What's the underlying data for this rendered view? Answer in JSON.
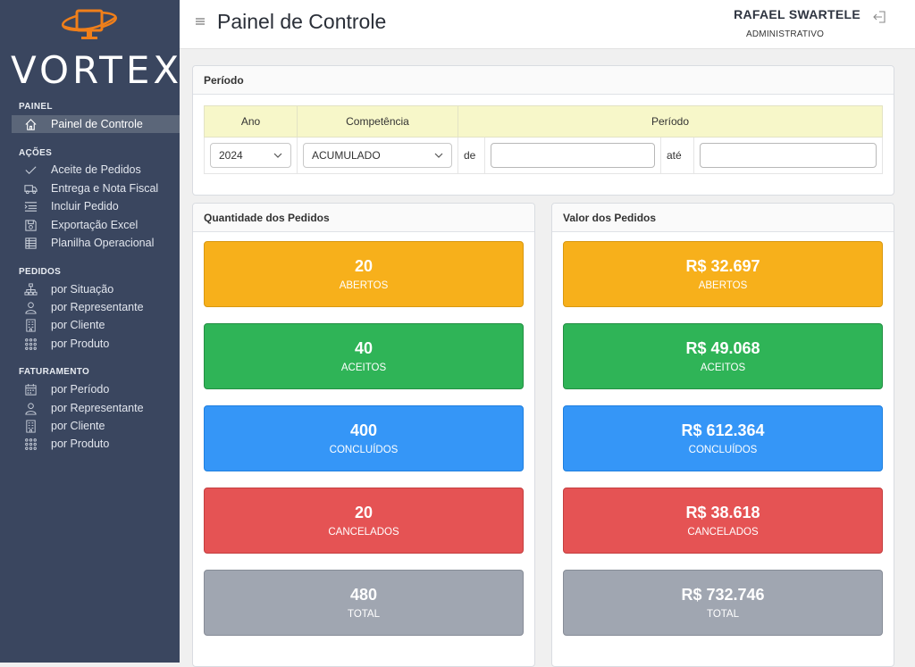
{
  "brand": {
    "name": "VORTEX",
    "accent": "#f07f1a"
  },
  "sidebar": {
    "sections": [
      {
        "title": "PAINEL",
        "items": [
          {
            "label": "Painel de Controle",
            "icon": "home-icon",
            "active": true
          }
        ]
      },
      {
        "title": "AÇÕES",
        "items": [
          {
            "label": "Aceite de Pedidos",
            "icon": "check-icon"
          },
          {
            "label": "Entrega e Nota Fiscal",
            "icon": "truck-icon"
          },
          {
            "label": "Incluir Pedido",
            "icon": "list-add-icon"
          },
          {
            "label": "Exportação Excel",
            "icon": "floppy-disk-icon"
          },
          {
            "label": "Planilha Operacional",
            "icon": "spreadsheet-icon"
          }
        ]
      },
      {
        "title": "PEDIDOS",
        "items": [
          {
            "label": "por Situação",
            "icon": "sitemap-icon"
          },
          {
            "label": "por Representante",
            "icon": "user-icon"
          },
          {
            "label": "por Cliente",
            "icon": "building-icon"
          },
          {
            "label": "por Produto",
            "icon": "grid-dots-icon"
          }
        ]
      },
      {
        "title": "FATURAMENTO",
        "items": [
          {
            "label": "por Período",
            "icon": "calendar-icon"
          },
          {
            "label": "por Representante",
            "icon": "user-icon"
          },
          {
            "label": "por Cliente",
            "icon": "building-icon"
          },
          {
            "label": "por Produto",
            "icon": "grid-dots-icon"
          }
        ]
      }
    ]
  },
  "header": {
    "title": "Painel de Controle",
    "user_name": "RAFAEL SWARTELE",
    "user_role": "ADMINISTRATIVO"
  },
  "period": {
    "title": "Período",
    "col_year": "Ano",
    "col_competence": "Competência",
    "col_period": "Período",
    "year_value": "2024",
    "competence_value": "ACUMULADO",
    "from_label": "de",
    "to_label": "até",
    "from_value": "",
    "to_value": ""
  },
  "quantity": {
    "title": "Quantidade dos Pedidos",
    "tiles": [
      {
        "value": "20",
        "label": "ABERTOS",
        "color": "#f7b01b"
      },
      {
        "value": "40",
        "label": "ACEITOS",
        "color": "#2fb457"
      },
      {
        "value": "400",
        "label": "CONCLUÍDOS",
        "color": "#3596f7"
      },
      {
        "value": "20",
        "label": "CANCELADOS",
        "color": "#e55354"
      },
      {
        "value": "480",
        "label": "TOTAL",
        "color": "#a0a6b1"
      }
    ]
  },
  "value": {
    "title": "Valor dos Pedidos",
    "tiles": [
      {
        "value": "R$ 32.697",
        "label": "ABERTOS",
        "color": "#f7b01b"
      },
      {
        "value": "R$ 49.068",
        "label": "ACEITOS",
        "color": "#2fb457"
      },
      {
        "value": "R$ 612.364",
        "label": "CONCLUÍDOS",
        "color": "#3596f7"
      },
      {
        "value": "R$ 38.618",
        "label": "CANCELADOS",
        "color": "#e55354"
      },
      {
        "value": "R$ 732.746",
        "label": "TOTAL",
        "color": "#a0a6b1"
      }
    ]
  }
}
